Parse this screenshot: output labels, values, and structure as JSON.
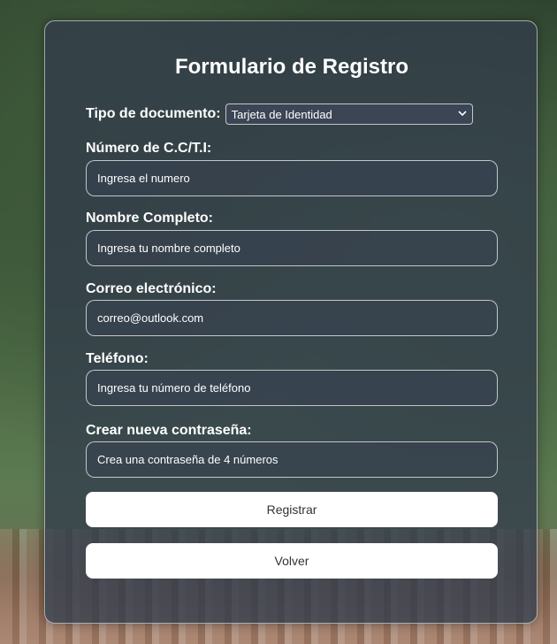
{
  "form": {
    "title": "Formulario de Registro",
    "document_type": {
      "label": "Tipo de documento:",
      "selected": "Tarjeta de Identidad"
    },
    "fields": [
      {
        "label": "Número de C.C/T.I:",
        "placeholder": "Ingresa el numero"
      },
      {
        "label": "Nombre Completo:",
        "placeholder": "Ingresa tu nombre completo"
      },
      {
        "label": "Correo electrónico:",
        "placeholder": "correo@outlook.com"
      },
      {
        "label": "Teléfono:",
        "placeholder": "Ingresa tu número de teléfono"
      },
      {
        "label": "Crear nueva contraseña:",
        "placeholder": "Crea una contraseña de 4 números"
      }
    ],
    "buttons": {
      "register": "Registrar",
      "back": "Volver"
    }
  },
  "icons": {
    "select_arrow": "chevron-down-icon"
  }
}
